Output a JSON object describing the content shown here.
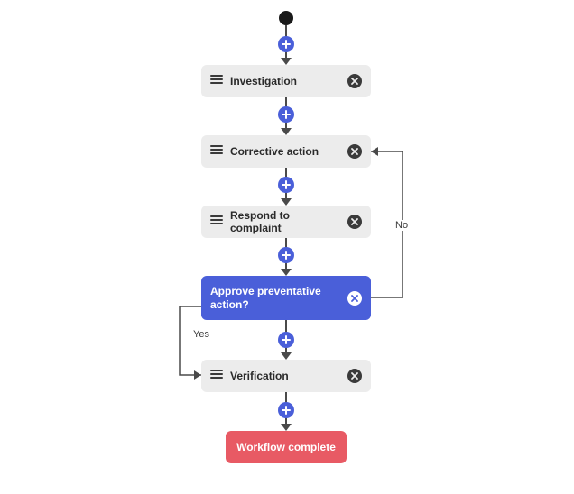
{
  "workflow": {
    "steps": [
      {
        "label": "Investigation"
      },
      {
        "label": "Corrective action"
      },
      {
        "label": "Respond to complaint"
      },
      {
        "label": "Approve preventative action?"
      },
      {
        "label": "Verification"
      }
    ],
    "decision": {
      "yes_label": "Yes",
      "no_label": "No"
    },
    "terminal": {
      "label": "Workflow complete"
    }
  },
  "colors": {
    "accent": "#4a5fd9",
    "terminal": "#e85a64",
    "step_bg": "#ececec"
  }
}
